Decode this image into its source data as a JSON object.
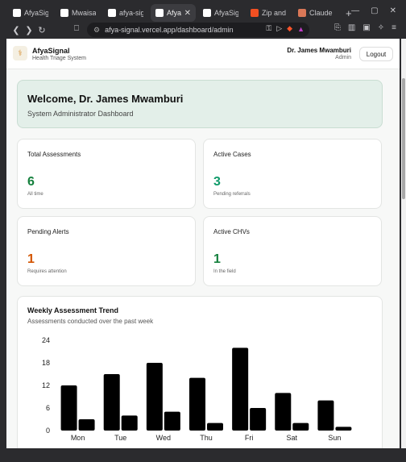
{
  "browser": {
    "tabs": [
      {
        "title": "AfyaSign",
        "icon": "afyasignal-favicon",
        "color": "#ffffff",
        "active": false
      },
      {
        "title": "Mwaisak",
        "icon": "github-icon",
        "color": "#ffffff",
        "active": false
      },
      {
        "title": "afya-sig",
        "icon": "vercel-icon",
        "color": "#ffffff",
        "active": false
      },
      {
        "title": "Afya",
        "icon": "page-icon",
        "color": "#ffffff",
        "active": true
      },
      {
        "title": "AfyaSig",
        "icon": "github-icon",
        "color": "#ffffff",
        "active": false
      },
      {
        "title": "Zip and c",
        "icon": "microsoft-icon",
        "color": "#f25022",
        "active": false
      },
      {
        "title": "Claude",
        "icon": "claude-icon",
        "color": "#d97757",
        "active": false
      }
    ],
    "url": "afya-signal.vercel.app/dashboard/admin"
  },
  "app": {
    "brand": "AfyaSignal",
    "tagline": "Health Triage System",
    "user_name": "Dr. James Mwamburi",
    "user_role": "Admin",
    "logout_label": "Logout"
  },
  "welcome": {
    "title": "Welcome, Dr. James Mwamburi",
    "subtitle": "System Administrator Dashboard"
  },
  "stats": [
    {
      "label": "Total Assessments",
      "value": "6",
      "caption": "All time",
      "color": "#15803d"
    },
    {
      "label": "Active Cases",
      "value": "3",
      "caption": "Pending referrals",
      "color": "#0f9a6a"
    },
    {
      "label": "Pending Alerts",
      "value": "1",
      "caption": "Requires attention",
      "color": "#d35400"
    },
    {
      "label": "Active CHVs",
      "value": "1",
      "caption": "In the field",
      "color": "#15803d"
    }
  ],
  "chart": {
    "title": "Weekly Assessment Trend",
    "subtitle": "Assessments conducted over the past week"
  },
  "chart_data": {
    "type": "bar",
    "categories": [
      "Mon",
      "Tue",
      "Wed",
      "Thu",
      "Fri",
      "Sat",
      "Sun"
    ],
    "series": [
      {
        "values": [
          12,
          15,
          18,
          14,
          22,
          10,
          8
        ]
      },
      {
        "values": [
          3,
          4,
          5,
          2,
          6,
          2,
          1
        ]
      }
    ],
    "yticks": [
      "0",
      "6",
      "12",
      "18",
      "24"
    ],
    "ylim": [
      0,
      24
    ],
    "bar_color": "#000000"
  }
}
